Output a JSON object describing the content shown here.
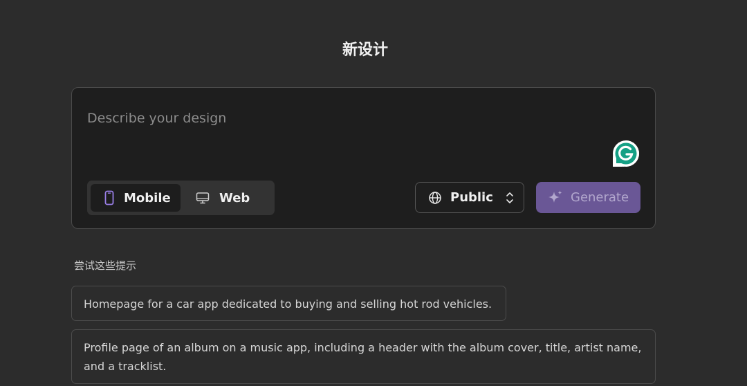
{
  "page": {
    "title": "新设计"
  },
  "composer": {
    "prompt_placeholder": "Describe your design",
    "prompt_value": "",
    "mode_options": [
      "Mobile",
      "Web"
    ],
    "selected_mode": "Mobile",
    "visibility": "Public",
    "generate_label": "Generate",
    "icons": {
      "mobile": "phone-icon",
      "web": "monitor-icon",
      "visibility": "globe-icon",
      "visibility_toggle": "up-down-chevron-icon",
      "generate": "sparkle-icon",
      "extension": "grammarly-icon"
    }
  },
  "suggestions": {
    "heading": "尝试这些提示",
    "items": [
      "Homepage for a car app dedicated to buying and selling hot rod vehicles.",
      "Profile page of an album on a music app, including a header with the album cover, title, artist name, and a tracklist."
    ]
  },
  "colors": {
    "background": "#2c2c2c",
    "panel": "#1e1e1e",
    "accent": "#6a5796",
    "accent_text": "#b2a7cd",
    "mobile_icon": "#9a7fe8",
    "grammarly": "#15a085"
  }
}
